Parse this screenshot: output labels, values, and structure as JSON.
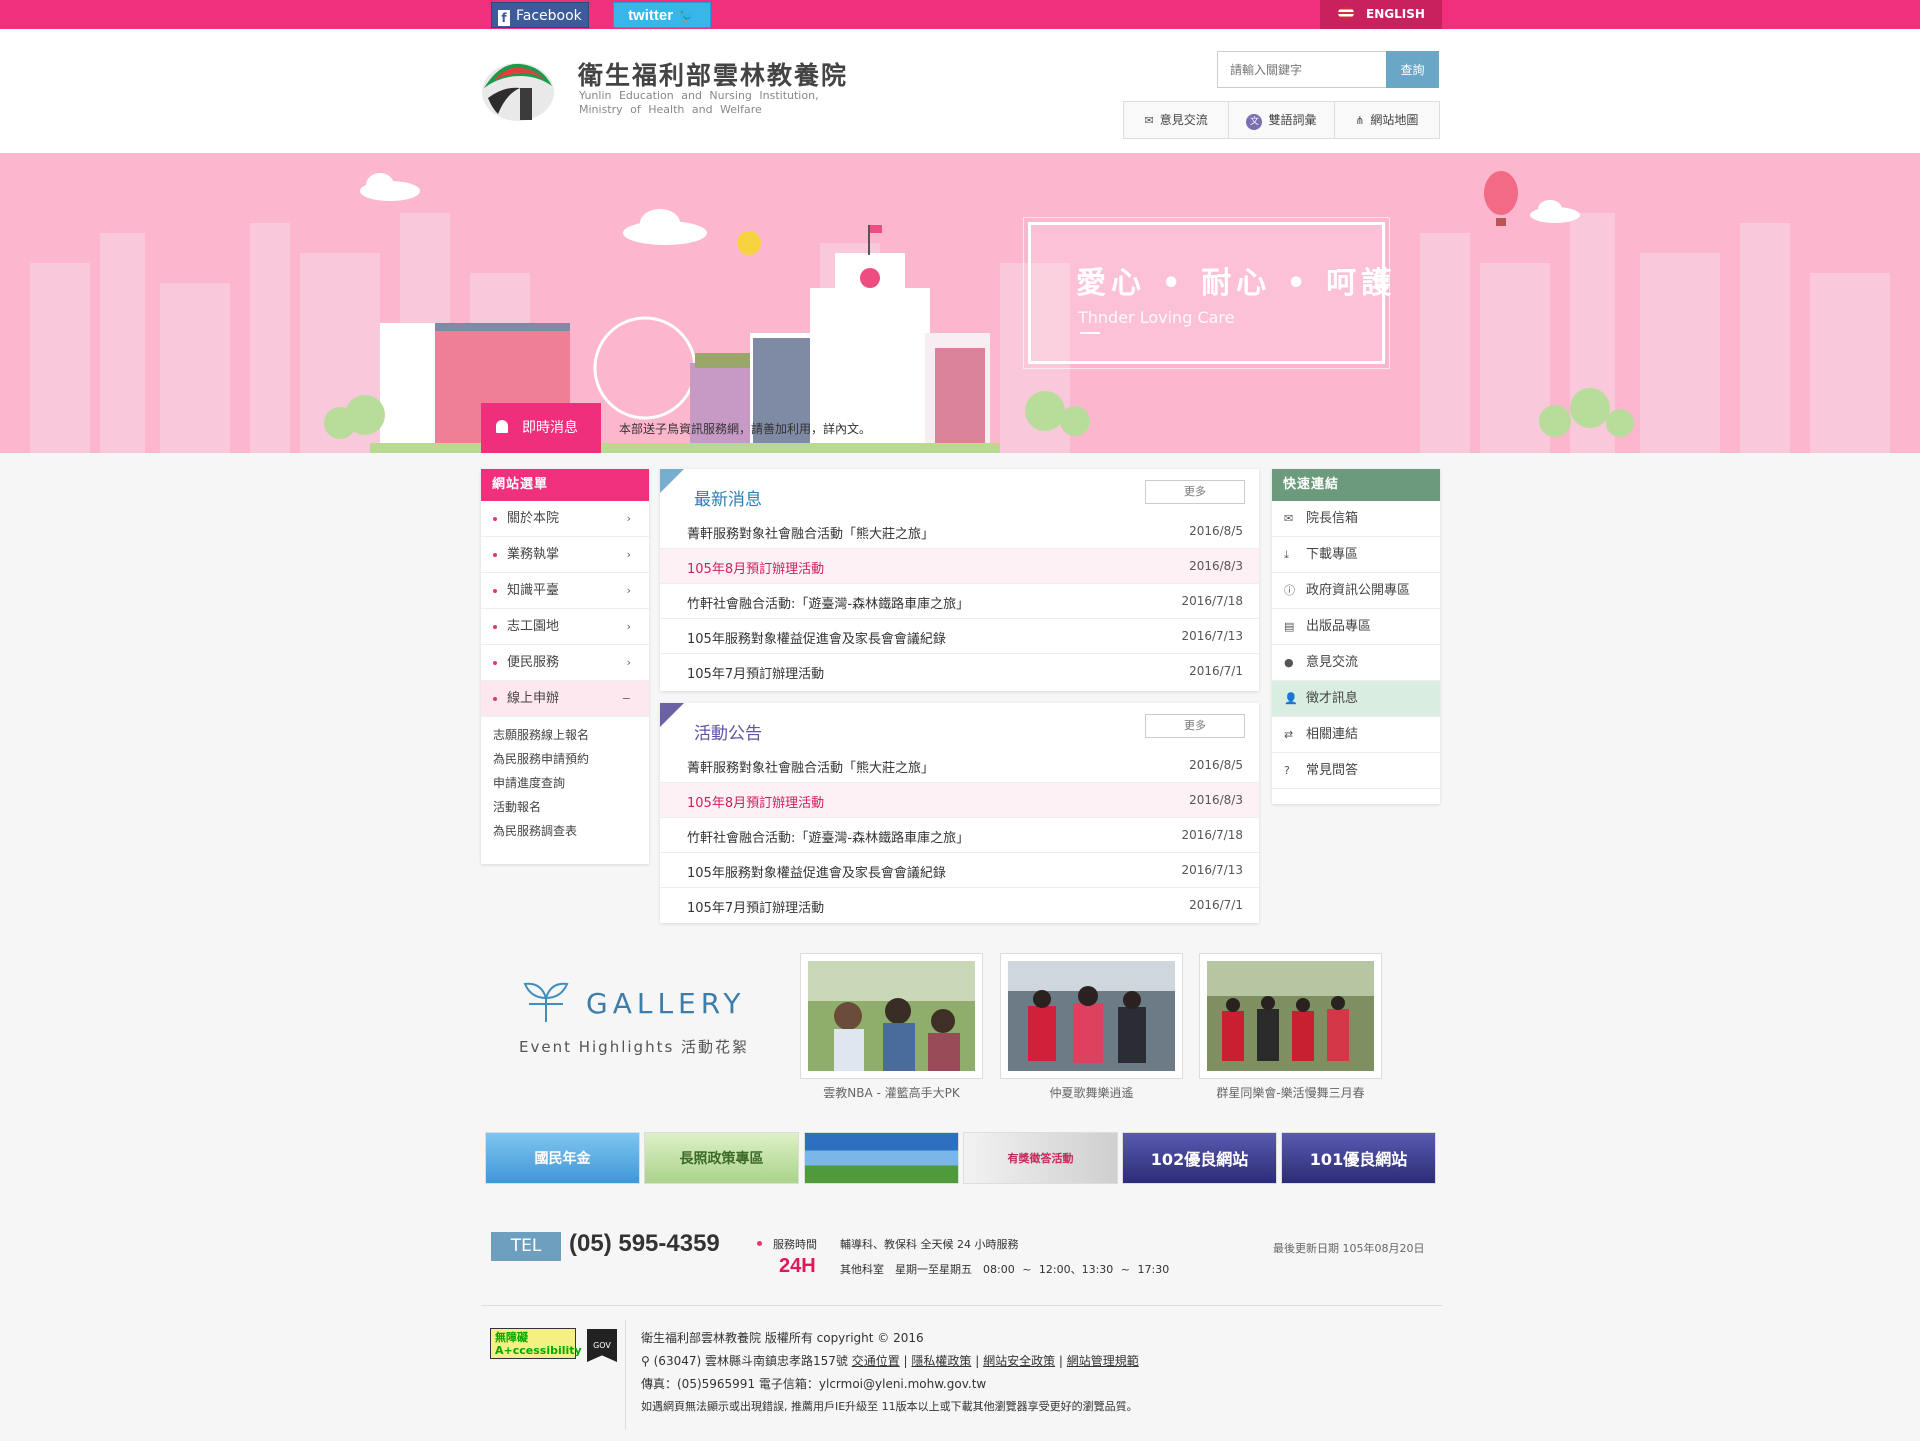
{
  "topbar": {
    "facebook": "Facebook",
    "twitter": "twitter",
    "english": "ENGLISH"
  },
  "header": {
    "title_zh": "衛生福利部雲林教養院",
    "title_en_line1": "Yunlin Education and Nursing Institution,",
    "title_en_line2": "Ministry of Health and Welfare",
    "search_placeholder": "請輸入關鍵字",
    "search_button": "查詢",
    "util_links": [
      "意見交流",
      "雙語詞彙",
      "網站地圖"
    ]
  },
  "banner": {
    "slogan_zh": "愛心 • 耐心 • 呵護",
    "slogan_en": "Thnder Loving Care",
    "news_label": "即時消息",
    "news_text": "本部送子鳥資訊服務網，請善加利用，詳內文。"
  },
  "leftmenu": {
    "title": "網站選單",
    "items": [
      "關於本院",
      "業務執掌",
      "知識平臺",
      "志工園地",
      "便民服務",
      "線上申辦"
    ],
    "subitems": [
      "志願服務線上報名",
      "為民服務申請預約",
      "申請進度查詢",
      "活動報名",
      "為民服務調查表"
    ]
  },
  "news": {
    "title": "最新消息",
    "more": "更多",
    "rows": [
      {
        "title": "菁軒服務對象社會融合活動「熊大莊之旅」",
        "date": "2016/8/5"
      },
      {
        "title": "105年8月預訂辦理活動",
        "date": "2016/8/3"
      },
      {
        "title": "竹軒社會融合活動:「遊臺灣-森林鐵路車庫之旅」",
        "date": "2016/7/18"
      },
      {
        "title": "105年服務對象權益促進會及家長會會議紀錄",
        "date": "2016/7/13"
      },
      {
        "title": "105年7月預訂辦理活動",
        "date": "2016/7/1"
      }
    ]
  },
  "events": {
    "title": "活動公告",
    "more": "更多",
    "rows": [
      {
        "title": "菁軒服務對象社會融合活動「熊大莊之旅」",
        "date": "2016/8/5"
      },
      {
        "title": "105年8月預訂辦理活動",
        "date": "2016/8/3"
      },
      {
        "title": "竹軒社會融合活動:「遊臺灣-森林鐵路車庫之旅」",
        "date": "2016/7/18"
      },
      {
        "title": "105年服務對象權益促進會及家長會會議紀錄",
        "date": "2016/7/13"
      },
      {
        "title": "105年7月預訂辦理活動",
        "date": "2016/7/1"
      }
    ]
  },
  "quicklinks": {
    "title": "快速連結",
    "items": [
      {
        "label": "院長信箱",
        "icon": "envelope-icon"
      },
      {
        "label": "下載專區",
        "icon": "download-icon"
      },
      {
        "label": "政府資訊公開專區",
        "icon": "info-icon"
      },
      {
        "label": "出版品專區",
        "icon": "newspaper-icon"
      },
      {
        "label": "意見交流",
        "icon": "comments-icon"
      },
      {
        "label": "徵才訊息",
        "icon": "user-plus-icon"
      },
      {
        "label": "相關連結",
        "icon": "random-icon"
      },
      {
        "label": "常見問答",
        "icon": "question-icon"
      }
    ]
  },
  "gallery": {
    "title": "GALLERY",
    "subtitle": "Event Highlights 活動花絮",
    "items": [
      "雲教NBA - 灌籃高手大PK",
      "仲夏歌舞樂逍遙",
      "群星同樂會-樂活慢舞三月春"
    ]
  },
  "banner_links": [
    {
      "label": "國民年金",
      "color": "#4aa3e0"
    },
    {
      "label": "長照政策專區",
      "color": "#b8d98f"
    },
    {
      "label": "",
      "color": "#3c7fc4"
    },
    {
      "label": "有獎徵答活動",
      "color": "#d8d8d8"
    },
    {
      "label": "102優良網站",
      "color": "#3a3a8a"
    },
    {
      "label": "101優良網站",
      "color": "#3a3a8a"
    }
  ],
  "footer": {
    "tel_label": "TEL",
    "tel_number": "(05) 595-4359",
    "service_label": "服務時間",
    "service_24h": "24H",
    "service_line1": "輔導科、教保科 全天候 24 小時服務",
    "service_line2": "其他科室　星期一至星期五　08:00 ~ 12:00、13:30 ~ 17:30",
    "updated": "最後更新日期 105年08月20日",
    "accessibility": "無障礙 A+ccessibility",
    "gov": "GOV",
    "copyright": "衛生福利部雲林教養院 版權所有 copyright © 2016",
    "address": "(63047) 雲林縣斗南鎮忠孝路157號",
    "links": [
      "交通位置",
      "隱私權政策",
      "網站安全政策",
      "網站管理規範"
    ],
    "contact": "傳真：(05)5965991 電子信箱：ylcrmoi@yleni.mohw.gov.tw",
    "notice": "如遇網頁無法顯示或出現錯誤, 推薦用戶IE升級至 11版本以上或下載其他瀏覽器享受更好的瀏覽品質。"
  }
}
